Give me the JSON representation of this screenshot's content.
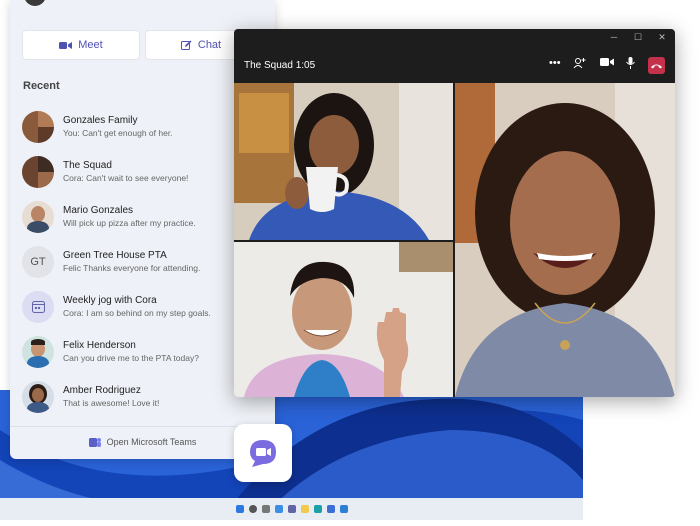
{
  "flyout": {
    "meet_label": "Meet",
    "chat_label": "Chat",
    "recent_heading": "Recent",
    "open_teams_label": "Open Microsoft Teams",
    "recent": [
      {
        "name": "Gonzales Family",
        "preview": "You: Can't get enough of her."
      },
      {
        "name": "The Squad",
        "preview": "Cora: Can't wait to see everyone!"
      },
      {
        "name": "Mario Gonzales",
        "preview": "Will pick up pizza after my practice."
      },
      {
        "name": "Green Tree House PTA",
        "preview": "Felic Thanks everyone for attending.",
        "initials": "GT"
      },
      {
        "name": "Weekly jog with Cora",
        "preview": "Cora: I am so behind on my step goals."
      },
      {
        "name": "Felix Henderson",
        "preview": "Can you drive me to the PTA today?"
      },
      {
        "name": "Amber Rodriguez",
        "preview": "That is awesome! Love it!"
      }
    ]
  },
  "call": {
    "title": "The Squad 1:05",
    "leave_color": "#c4314b"
  },
  "colors": {
    "accent": "#4f52b2"
  }
}
